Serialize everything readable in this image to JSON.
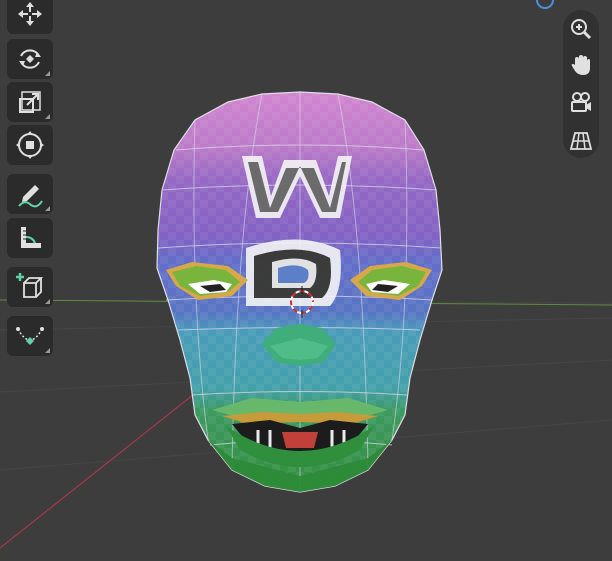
{
  "viewport": {
    "background": "#3d3d3d",
    "grid_line_color": "#4d4d4d",
    "x_axis_color": "#a33a45",
    "y_axis_color": "#5a8a3a"
  },
  "toolbar": {
    "tools": [
      {
        "name": "move",
        "icon": "move-icon"
      },
      {
        "name": "rotate",
        "icon": "rotate-icon"
      },
      {
        "name": "scale",
        "icon": "scale-icon"
      },
      {
        "name": "transform",
        "icon": "transform-icon"
      },
      {
        "name": "annotate",
        "icon": "annotate-icon"
      },
      {
        "name": "measure",
        "icon": "measure-icon"
      },
      {
        "name": "add-cube",
        "icon": "add-cube-icon"
      },
      {
        "name": "spin",
        "icon": "spin-icon"
      }
    ]
  },
  "navigation": {
    "items": [
      {
        "name": "zoom",
        "icon": "zoom-icon"
      },
      {
        "name": "pan",
        "icon": "hand-icon"
      },
      {
        "name": "camera",
        "icon": "camera-icon"
      },
      {
        "name": "perspective",
        "icon": "grid-icon"
      }
    ]
  },
  "model": {
    "object": "textured-head",
    "texture_letters": [
      "W",
      "D"
    ],
    "band_colors": [
      "#d88bd0",
      "#9a67c9",
      "#5f6fd0",
      "#48a8b8",
      "#3a9a52"
    ]
  }
}
